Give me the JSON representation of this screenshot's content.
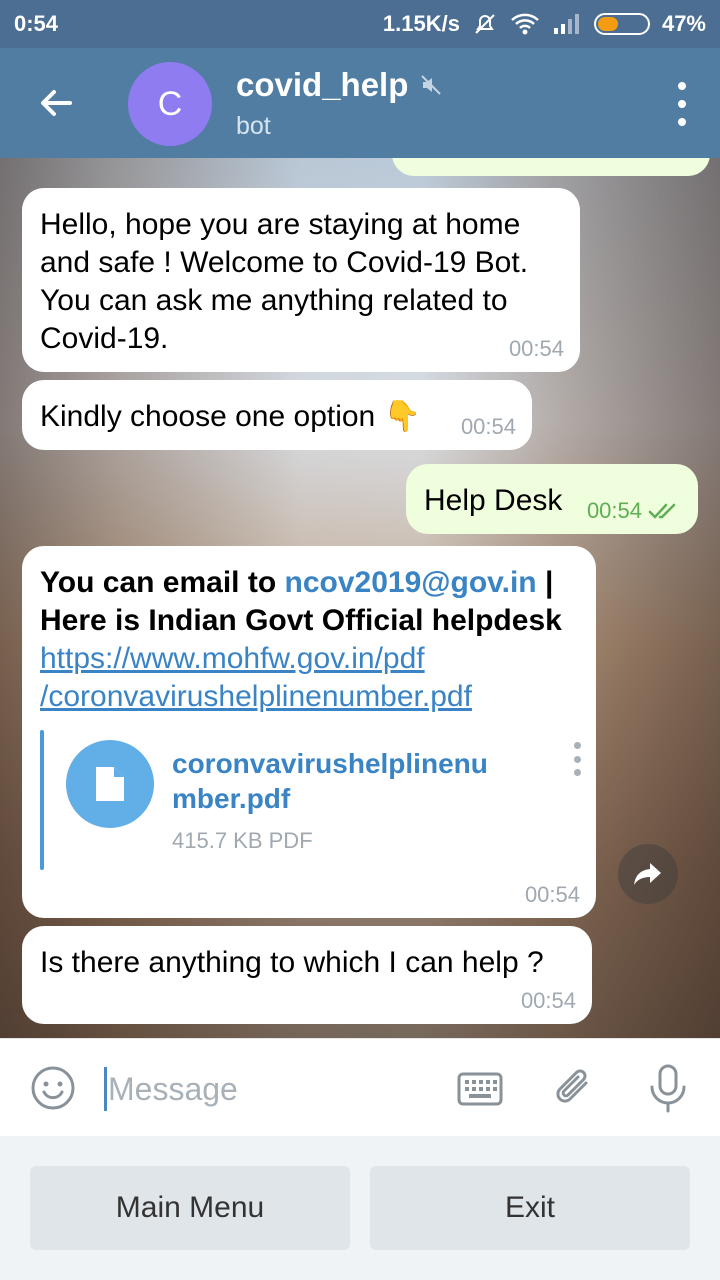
{
  "status_bar": {
    "time": "0:54",
    "speed": "1.15K/s",
    "battery": "47%",
    "battery_level": 0.47
  },
  "header": {
    "avatar_letter": "C",
    "title": "covid_help",
    "subtitle": "bot"
  },
  "messages": [
    {
      "text": "Hello, hope you are staying at home and safe ! Welcome to Covid-19 Bot. You can ask me anything related to Covid-19.",
      "time": "00:54"
    },
    {
      "text": "Kindly choose one option 👇",
      "time": "00:54"
    },
    {
      "text": "Help Desk",
      "time": "00:54"
    },
    {
      "text_prefix": "You can email to",
      "email": "ncov2019@gov.in",
      "text_suffix": "| Here is Indian Govt Official helpdesk",
      "link_line1": "https://www.mohfw.gov.in/pdf",
      "link_line2": "/coronvavirushelplinenumber.pdf",
      "doc_name": "coronvavirushelplinenumber.pdf",
      "doc_size": "415.7 KB PDF",
      "time": "00:54"
    },
    {
      "text": "Is there anything to which I can help ?",
      "time": "00:54"
    }
  ],
  "input": {
    "placeholder": "Message"
  },
  "keyboard": {
    "buttons": [
      "Main Menu",
      "Exit"
    ]
  },
  "colors": {
    "header": "#527da3",
    "avatar": "#8e7cf0",
    "link": "#3a83c4",
    "outgoing_bubble": "#effedd"
  }
}
